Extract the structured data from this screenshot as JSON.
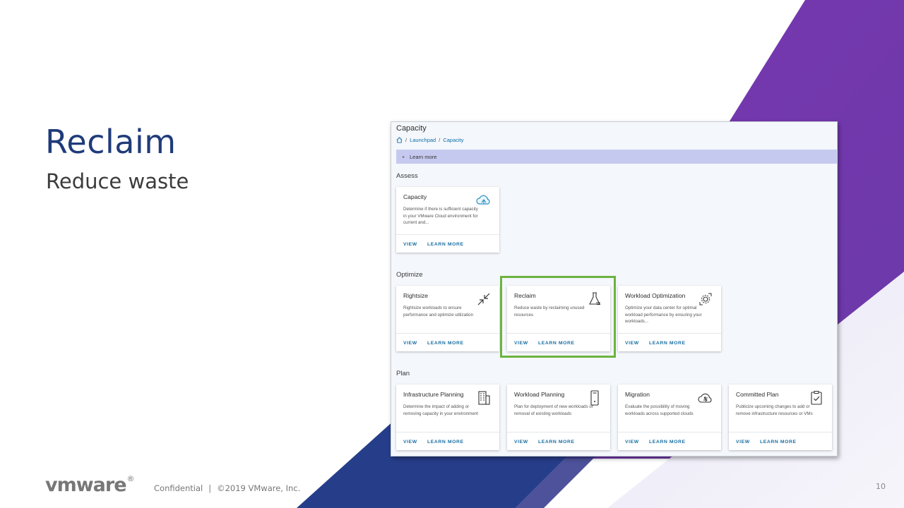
{
  "slide": {
    "title": "Reclaim",
    "subtitle": "Reduce waste",
    "logo": "vmware",
    "footer_confidential": "Confidential",
    "footer_separator": "|",
    "footer_copyright": "©2019 VMware, Inc.",
    "page_number": "10"
  },
  "colors": {
    "title": "#1f3b7a",
    "purple": "#7b3fb0",
    "navy": "#263e8a",
    "highlight": "#6db33f",
    "link": "#1a6fa3",
    "banner": "#c6c9ef"
  },
  "app": {
    "page_title": "Capacity",
    "breadcrumb": {
      "home_icon": "home-icon",
      "items": [
        "Launchpad",
        "Capacity"
      ],
      "separator": "/"
    },
    "banner": {
      "label": "Learn more",
      "icon": "chevron-right-icon"
    },
    "sections": [
      {
        "title": "Assess",
        "cards": [
          {
            "title": "Capacity",
            "desc": "Determine if there is sufficient capacity in your VMware Cloud environment for current and...",
            "icon": "cloud-capacity-icon",
            "view": "VIEW",
            "learn": "LEARN MORE"
          }
        ]
      },
      {
        "title": "Optimize",
        "cards": [
          {
            "title": "Rightsize",
            "desc": "Rightsize workloads to ensure performance and optimize utilization",
            "icon": "compress-arrows-icon",
            "view": "VIEW",
            "learn": "LEARN MORE"
          },
          {
            "title": "Reclaim",
            "desc": "Reduce waste by reclaiming unused resources",
            "icon": "reclaim-flask-icon",
            "view": "VIEW",
            "learn": "LEARN MORE"
          },
          {
            "title": "Workload Optimization",
            "desc": "Optimize your data center for optimal workload performance by ensuring your workloads...",
            "icon": "gear-cycle-icon",
            "view": "VIEW",
            "learn": "LEARN MORE"
          }
        ]
      },
      {
        "title": "Plan",
        "cards": [
          {
            "title": "Infrastructure Planning",
            "desc": "Determine the impact of adding or removing capacity in your environment",
            "icon": "building-icon",
            "view": "VIEW",
            "learn": "LEARN MORE"
          },
          {
            "title": "Workload Planning",
            "desc": "Plan for deployment of new workloads or removal of existing workloads",
            "icon": "device-icon",
            "view": "VIEW",
            "learn": "LEARN MORE"
          },
          {
            "title": "Migration",
            "desc": "Evaluate the possibility of moving workloads across supported clouds",
            "icon": "cloud-migrate-icon",
            "view": "VIEW",
            "learn": "LEARN MORE"
          },
          {
            "title": "Committed Plan",
            "desc": "Publicize upcoming changes to add or remove infrastructure resources or VMs",
            "icon": "clipboard-check-icon",
            "view": "VIEW",
            "learn": "LEARN MORE"
          }
        ]
      }
    ]
  }
}
